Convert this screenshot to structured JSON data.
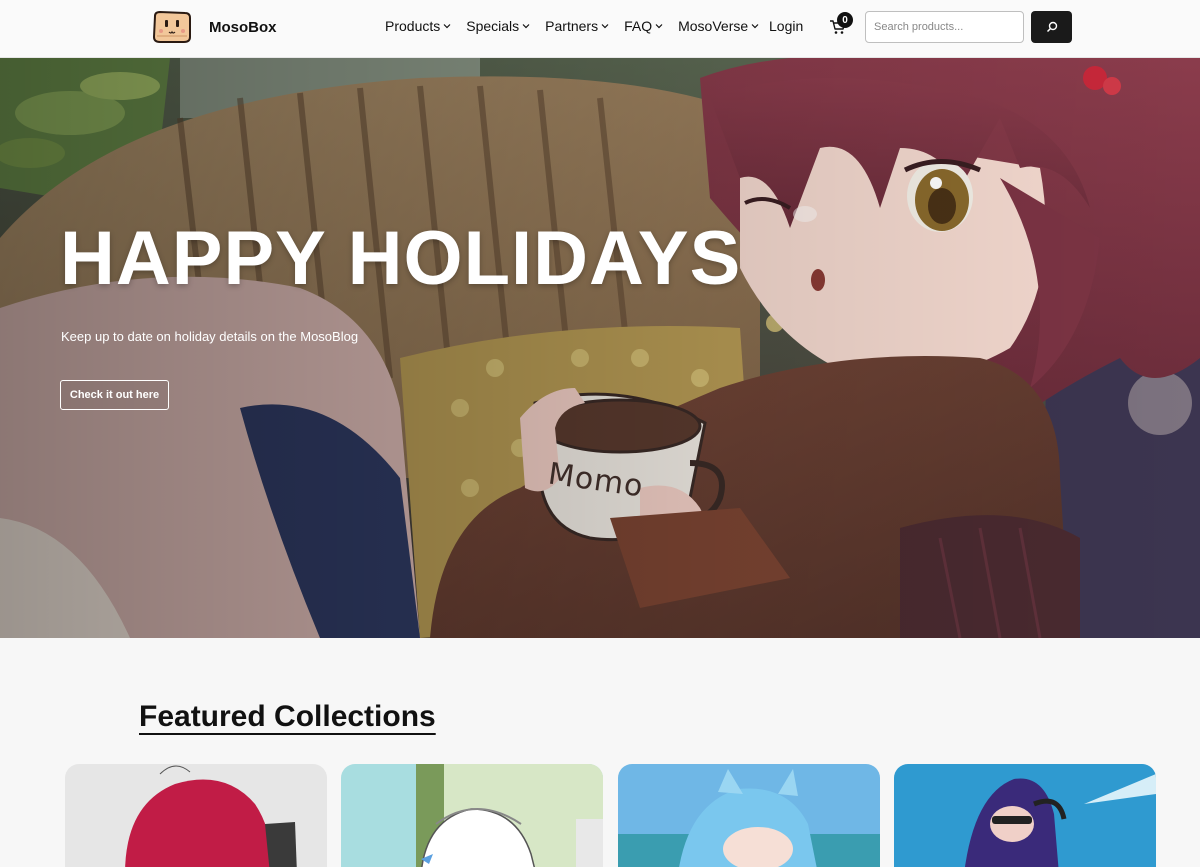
{
  "brand": {
    "name": "MosoBox"
  },
  "nav": {
    "items": [
      {
        "label": "Products"
      },
      {
        "label": "Specials"
      },
      {
        "label": "Partners"
      },
      {
        "label": "FAQ"
      },
      {
        "label": "MosoVerse"
      }
    ],
    "login_label": "Login",
    "cart_count": "0"
  },
  "search": {
    "placeholder": "Search products..."
  },
  "hero": {
    "title": "HAPPY HOLIDAYS",
    "subtitle": "Keep up to date on holiday details on the MosoBlog",
    "cta_label": "Check it out here",
    "mug_text": "Momo"
  },
  "featured": {
    "title": "Featured Collections"
  },
  "icons": {
    "chevron": "chevron-down-icon",
    "cart": "cart-icon",
    "search": "search-icon"
  },
  "colors": {
    "accent": "#1a1a1a",
    "hair": "#8a3c4a",
    "background": "#f7f7f7"
  }
}
